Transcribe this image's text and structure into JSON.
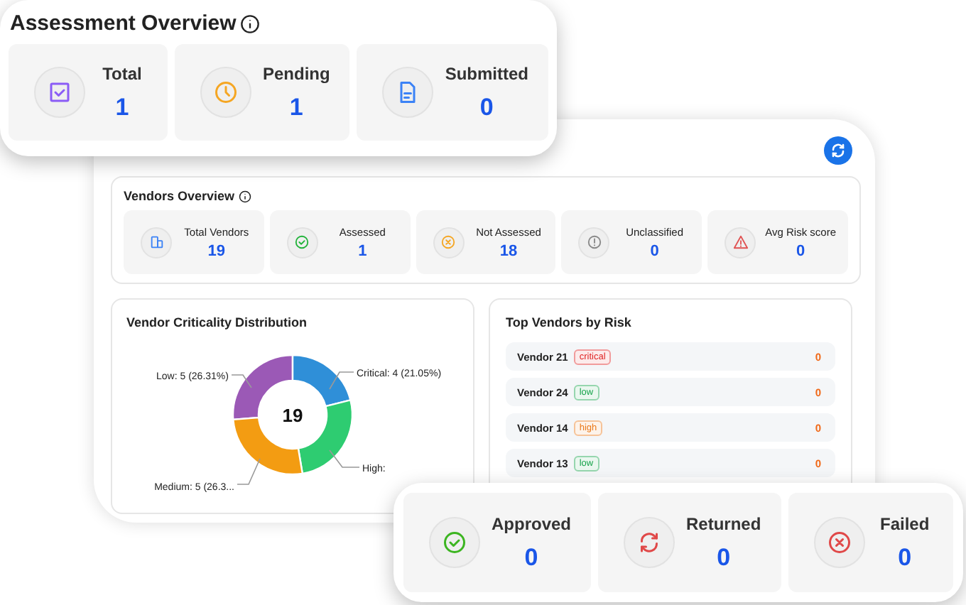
{
  "assessment_overview": {
    "title": "Assessment Overview",
    "stats": [
      {
        "kind": "total",
        "label": "Total",
        "value": "1"
      },
      {
        "kind": "pending",
        "label": "Pending",
        "value": "1"
      },
      {
        "kind": "submitted",
        "label": "Submitted",
        "value": "0"
      }
    ]
  },
  "vendors_overview": {
    "title": "Vendors Overview",
    "stats": [
      {
        "kind": "vendors",
        "label": "Total Vendors",
        "value": "19"
      },
      {
        "kind": "assessed",
        "label": "Assessed",
        "value": "1"
      },
      {
        "kind": "not_assessed",
        "label": "Not Assessed",
        "value": "18"
      },
      {
        "kind": "unclassified",
        "label": "Unclassified",
        "value": "0"
      },
      {
        "kind": "risk",
        "label": "Avg Risk score",
        "value": "0"
      }
    ]
  },
  "criticality": {
    "title": "Vendor Criticality Distribution",
    "total": "19",
    "labels": [
      {
        "text": "Low: 5 (26.31%)",
        "color": "#9b59b6"
      },
      {
        "text": "Critical: 4 (21.05%)",
        "color": "#2f8fd8"
      },
      {
        "text": "High:",
        "color": "#2ecc71"
      },
      {
        "text": "Medium: 5 (26.3...",
        "color": "#f39c12"
      }
    ],
    "chart_data": {
      "type": "donut",
      "values": [
        26.31,
        21.05,
        26.32,
        26.32
      ]
    }
  },
  "top_vendors": {
    "title": "Top Vendors by Risk",
    "rows": [
      {
        "name": "Vendor 21",
        "badge": "critical",
        "color": "#e02424",
        "score": "0"
      },
      {
        "name": "Vendor 24",
        "badge": "low",
        "color": "#16a34a",
        "score": "0"
      },
      {
        "name": "Vendor 14",
        "badge": "high",
        "color": "#ea7a1a",
        "score": "0"
      },
      {
        "name": "Vendor 13",
        "badge": "low",
        "color": "#16a34a",
        "score": "0"
      }
    ]
  },
  "review_outcomes": {
    "stats": [
      {
        "kind": "approved",
        "label": "Approved",
        "value": "0"
      },
      {
        "kind": "returned",
        "label": "Returned",
        "value": "0"
      },
      {
        "kind": "failed",
        "label": "Failed",
        "value": "0"
      }
    ]
  }
}
